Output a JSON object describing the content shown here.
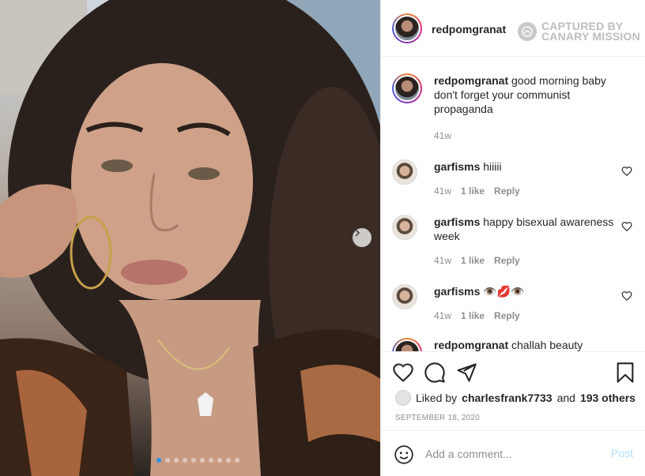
{
  "post": {
    "username": "redpomgranat"
  },
  "watermark": {
    "line1": "CAPTURED BY",
    "line2": "CANARY MISSION"
  },
  "caption": {
    "username": "redpomgranat",
    "text": "good morning baby don't forget your communist propaganda",
    "age": "41w"
  },
  "comments": [
    {
      "username": "garfisms",
      "text": "hiiiii",
      "age": "41w",
      "likes": "1 like",
      "reply": "Reply"
    },
    {
      "username": "garfisms",
      "text": "happy bisexual awareness week",
      "age": "41w",
      "likes": "1 like",
      "reply": "Reply"
    },
    {
      "username": "garfisms",
      "text": "👁️💋👁️",
      "age": "41w",
      "likes": "1 like",
      "reply": "Reply"
    },
    {
      "username": "redpomgranat",
      "text": "challah beauty",
      "age": "",
      "likes": "",
      "reply": ""
    }
  ],
  "likes": {
    "prefix": "Liked by",
    "user": "charlesfrank7733",
    "conjunction": "and",
    "others": "193 others"
  },
  "date": "SEPTEMBER 18, 2020",
  "add_comment": {
    "placeholder": "Add a comment...",
    "post_label": "Post"
  },
  "carousel": {
    "total_slides": 10,
    "active_index": 0
  },
  "colors": {
    "text": "#262626",
    "muted": "#8e8e8e",
    "post_disabled": "#b2dffc",
    "active_dot": "#2f8fed"
  }
}
